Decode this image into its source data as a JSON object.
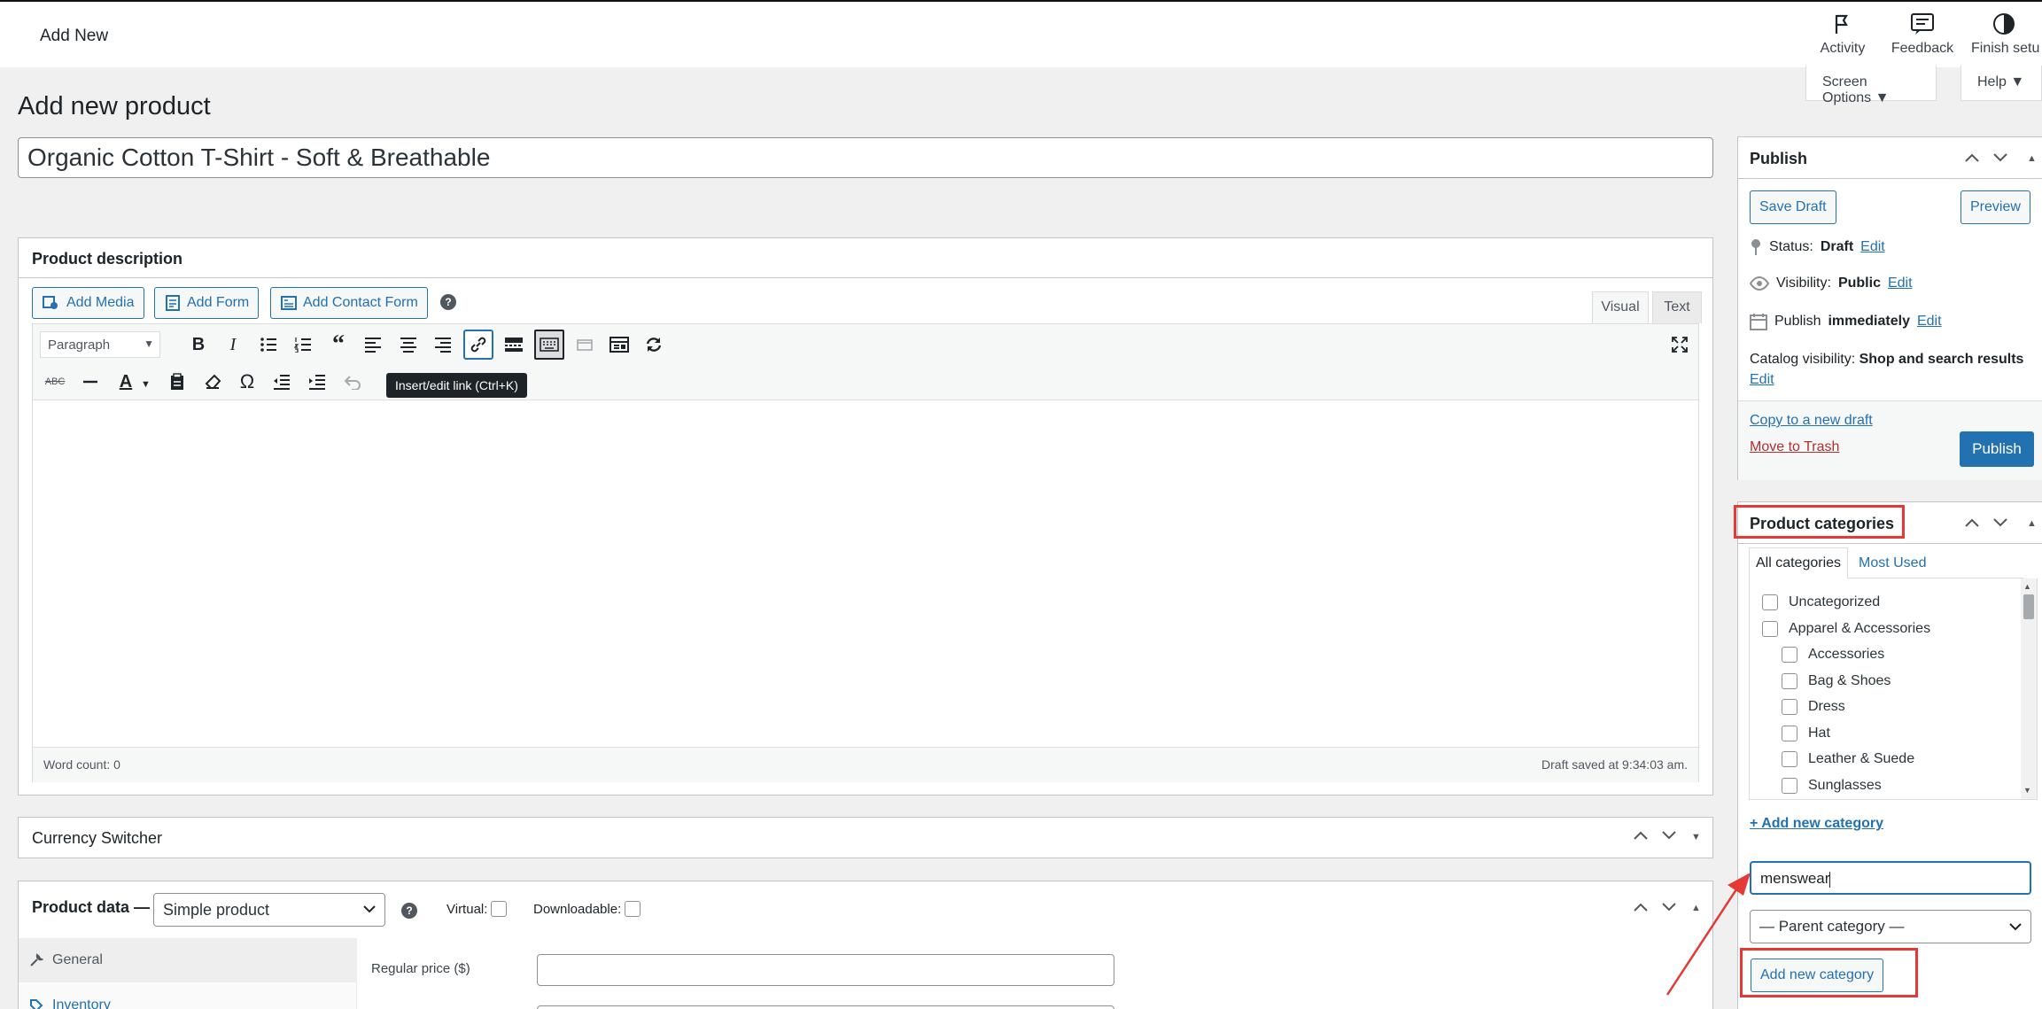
{
  "topbar": {
    "title": "Add New",
    "activity": "Activity",
    "feedback": "Feedback",
    "finish_setup": "Finish setu"
  },
  "screen_options": "Screen Options",
  "help": "Help",
  "page_title": "Add new product",
  "product_title_value": "Organic Cotton T-Shirt - Soft & Breathable",
  "description": {
    "heading": "Product description",
    "add_media": "Add Media",
    "add_form": "Add Form",
    "add_contact_form": "Add Contact Form",
    "tab_visual": "Visual",
    "tab_text": "Text",
    "format_select": "Paragraph",
    "tooltip": "Insert/edit link (Ctrl+K)",
    "word_count": "Word count: 0",
    "draft_saved": "Draft saved at 9:34:03 am."
  },
  "currency_switcher": "Currency Switcher",
  "product_data": {
    "label": "Product data —",
    "type_value": "Simple product",
    "virtual": "Virtual:",
    "downloadable": "Downloadable:",
    "tab_general": "General",
    "tab_inventory": "Inventory",
    "regular_price": "Regular price ($)"
  },
  "publish": {
    "heading": "Publish",
    "save_draft": "Save Draft",
    "preview": "Preview",
    "status_label": "Status:",
    "status_value": "Draft",
    "visibility_label": "Visibility:",
    "visibility_value": "Public",
    "publish_label": "Publish",
    "publish_value": "immediately",
    "catalog_label": "Catalog visibility:",
    "catalog_value": "Shop and search results",
    "edit": "Edit",
    "copy_draft": "Copy to a new draft",
    "trash": "Move to Trash",
    "publish_button": "Publish"
  },
  "categories": {
    "heading": "Product categories",
    "tab_all": "All categories",
    "tab_most_used": "Most Used",
    "items": [
      {
        "label": "Uncategorized",
        "level": 0,
        "checked": false
      },
      {
        "label": "Apparel & Accessories",
        "level": 0,
        "checked": false
      },
      {
        "label": "Accessories",
        "level": 1,
        "checked": false
      },
      {
        "label": "Bag & Shoes",
        "level": 1,
        "checked": false
      },
      {
        "label": "Dress",
        "level": 1,
        "checked": false
      },
      {
        "label": "Hat",
        "level": 1,
        "checked": false
      },
      {
        "label": "Leather & Suede",
        "level": 1,
        "checked": false
      },
      {
        "label": "Sunglasses",
        "level": 1,
        "checked": false
      }
    ],
    "add_new_link": "+ Add new category",
    "new_category_value": "menswear",
    "parent_select": "— Parent category —",
    "add_button": "Add new category"
  },
  "colors": {
    "accent": "#2271b1",
    "annotation": "#e53935",
    "trash": "#b32d2e"
  }
}
